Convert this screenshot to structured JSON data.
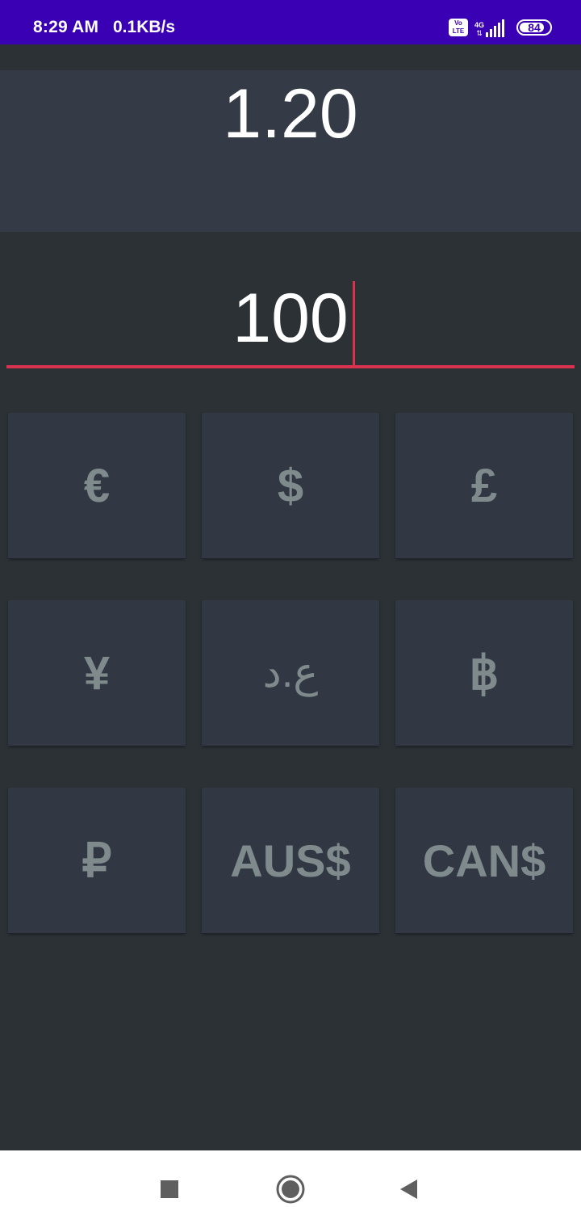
{
  "status_bar": {
    "time": "8:29 AM",
    "speed": "0.1KB/s",
    "volte_line1": "Vo",
    "volte_line2": "LTE",
    "network": "4G",
    "battery": "84",
    "battery_level": 0.84,
    "background_color": "#3a00b4"
  },
  "result": {
    "value": "1.20"
  },
  "amount_input": {
    "value": "100",
    "accent_color": "#d9324f"
  },
  "currencies": [
    {
      "label": "€"
    },
    {
      "label": "$"
    },
    {
      "label": "£"
    },
    {
      "label": "¥"
    },
    {
      "label": "ع.د"
    },
    {
      "label": "฿"
    },
    {
      "label": "₽"
    },
    {
      "label": "AUS$"
    },
    {
      "label": "CAN$"
    }
  ],
  "nav_bar": {
    "icons": [
      "recents-square-icon",
      "home-circle-icon",
      "back-triangle-icon"
    ]
  }
}
